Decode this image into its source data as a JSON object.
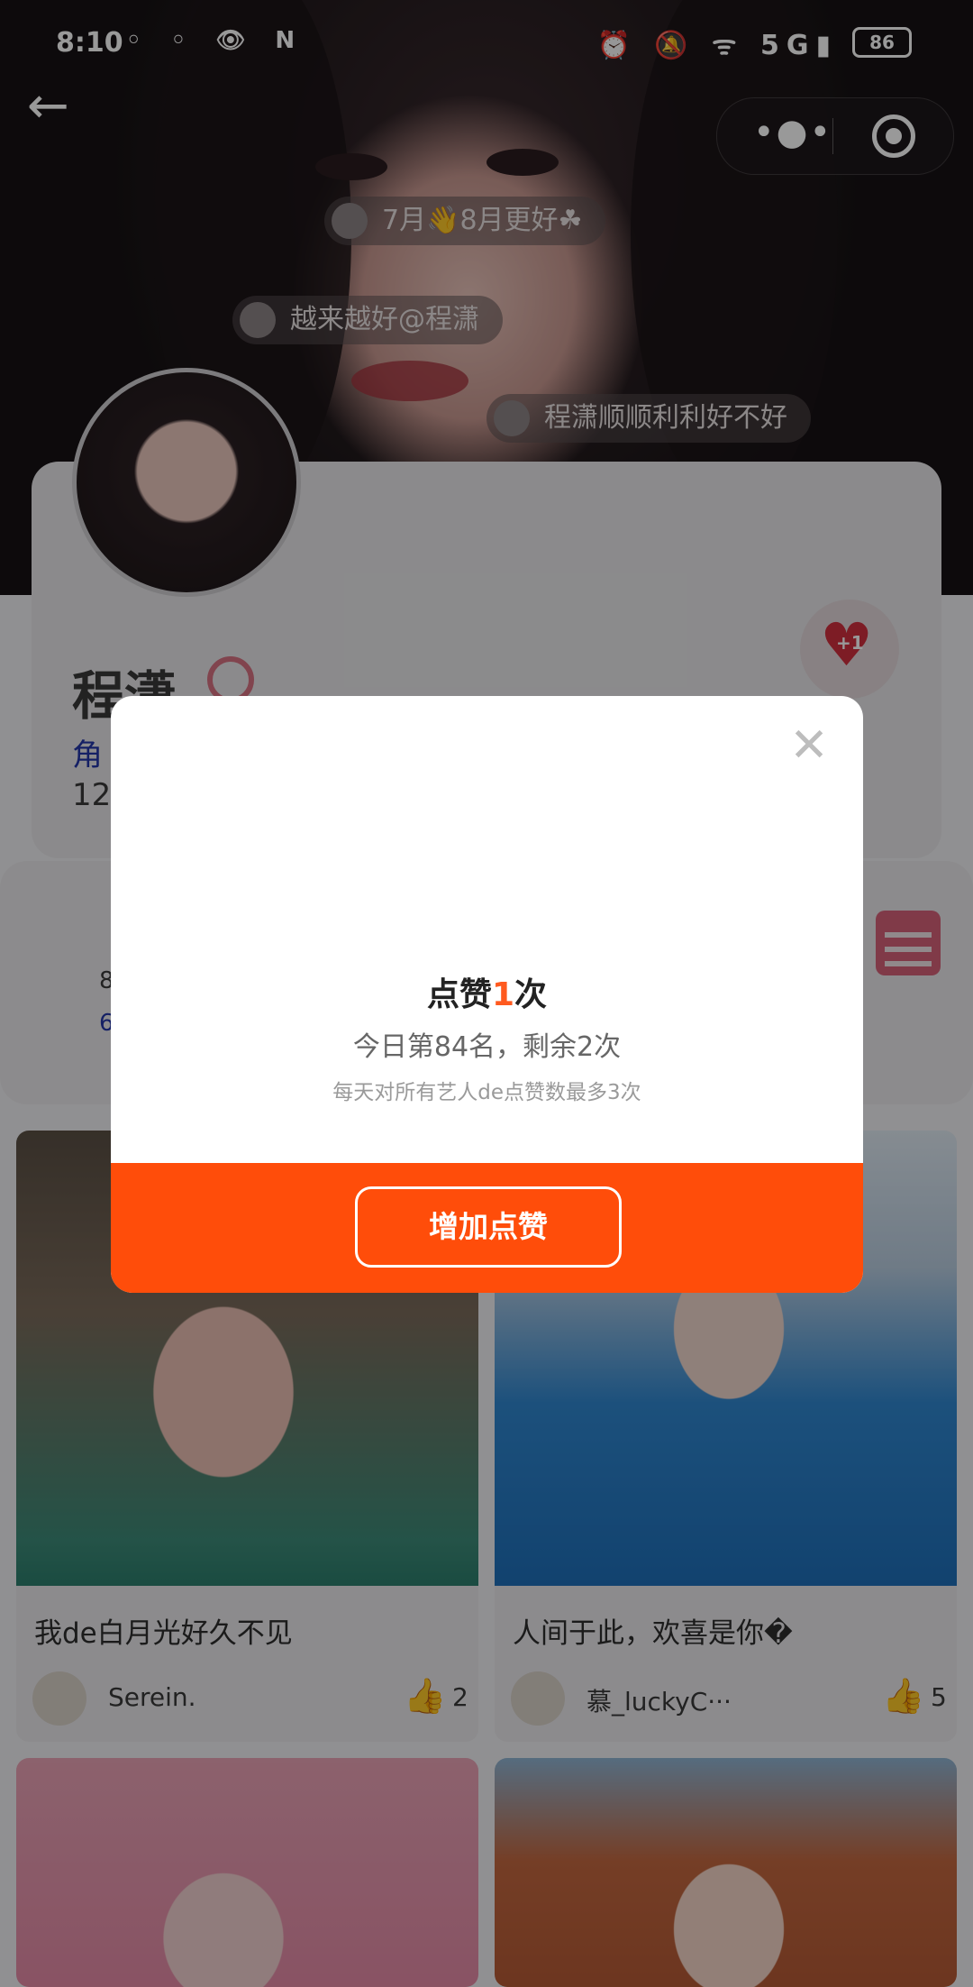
{
  "status_bar": {
    "time": "8:10",
    "battery": "86",
    "network": "5G"
  },
  "danmaku": [
    {
      "text": "7月👋8月更好☘"
    },
    {
      "text": "越来越好@程潇"
    },
    {
      "text": "程潇顺顺利利好不好"
    }
  ],
  "profile": {
    "name": "程潇",
    "role_fragment": "角",
    "count_fragment": "12",
    "like_badge": "+1"
  },
  "stats": {
    "line1": "",
    "line2": "8",
    "line3": "6"
  },
  "posts": [
    {
      "caption": "我de白月光好久不见",
      "author": "Serein.",
      "likes": "2"
    },
    {
      "caption": "人间于此，欢喜是你�",
      "author": "慕_luckyC···",
      "likes": "5"
    },
    {
      "caption": "",
      "author": "",
      "likes": ""
    },
    {
      "caption": "",
      "author": "",
      "likes": ""
    }
  ],
  "modal": {
    "title_prefix": "点赞",
    "title_number": "1",
    "title_suffix": "次",
    "rank_text": "今日第84名，剩余2次",
    "limit_text": "每天对所有艺人de点赞数最多3次",
    "button_label": "增加点赞"
  },
  "colors": {
    "accent": "#ff4d0a",
    "highlight": "#ff5a1f"
  }
}
